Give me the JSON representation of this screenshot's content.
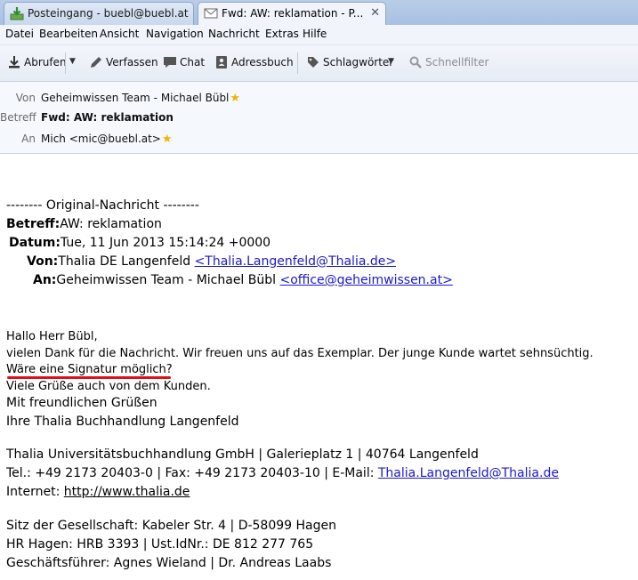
{
  "tabs": [
    {
      "label": "Posteingang - buebl@buebl.at",
      "icon": "inbox-download-icon"
    },
    {
      "label": "Fwd: AW: reklamation - P...",
      "icon": "envelope-icon",
      "close": "✕"
    }
  ],
  "menu": [
    "Datei",
    "Bearbeiten",
    "Ansicht",
    "Navigation",
    "Nachricht",
    "Extras",
    "Hilfe"
  ],
  "toolbar": {
    "abrufen": "Abrufen",
    "verfassen": "Verfassen",
    "chat": "Chat",
    "adressbuch": "Adressbuch",
    "schlagwoerter": "Schlagwörter",
    "schnellfilter": "Schnellfilter"
  },
  "header": {
    "von_label": "Von",
    "von_value": "Geheimwissen Team - Michael Bübl",
    "betreff_label": "Betreff",
    "betreff_value": "Fwd: AW: reklamation",
    "an_label": "An",
    "an_value": "Mich <mic@buebl.at>"
  },
  "message": {
    "original_header": "-------- Original-Nachricht --------",
    "betreff_label": "Betreff:",
    "betreff_value": "AW: reklamation",
    "datum_label": "Datum:",
    "datum_value": "Tue, 11 Jun 2013 15:14:24 +0000",
    "von_label": "Von:",
    "von_name": "Thalia DE Langenfeld ",
    "von_email": "<Thalia.Langenfeld@Thalia.de>",
    "an_label": "An:",
    "an_name": "Geheimwissen Team - Michael Bübl ",
    "an_email": "<office@geheimwissen.at>",
    "greeting": "Hallo Herr Bübl,",
    "line1": "vielen Dank für die Nachricht. Wir freuen uns auf das Exemplar. Der junge Kunde wartet sehnsüchtig.",
    "line2": "Wäre eine Signatur möglich?",
    "line3": "Viele Grüße auch von dem Kunden.",
    "line4": "Mit freundlichen Grüßen",
    "line5": "Ihre Thalia Buchhandlung Langenfeld",
    "company": "Thalia Universitätsbuchhandlung GmbH | Galerieplatz 1 | 40764 Langenfeld",
    "contact_prefix": "Tel.: +49 2173 20403-0 | Fax: +49 2173 20403-10 | E-Mail: ",
    "contact_email": "Thalia.Langenfeld@Thalia.de",
    "internet_prefix": "Internet: ",
    "internet_url": "http://www.thalia.de",
    "sitz": "Sitz der Gesellschaft: Kabeler Str. 4 | D-58099 Hagen",
    "hr": "HR Hagen: HRB 3393 | Ust.IdNr.: DE 812 277 765",
    "gf": "Geschäftsführer: Agnes Wieland | Dr. Andreas Laabs"
  },
  "colors": {
    "link": "#1a1ac8",
    "annotation": "#e0101a",
    "star": "#f2b400"
  }
}
